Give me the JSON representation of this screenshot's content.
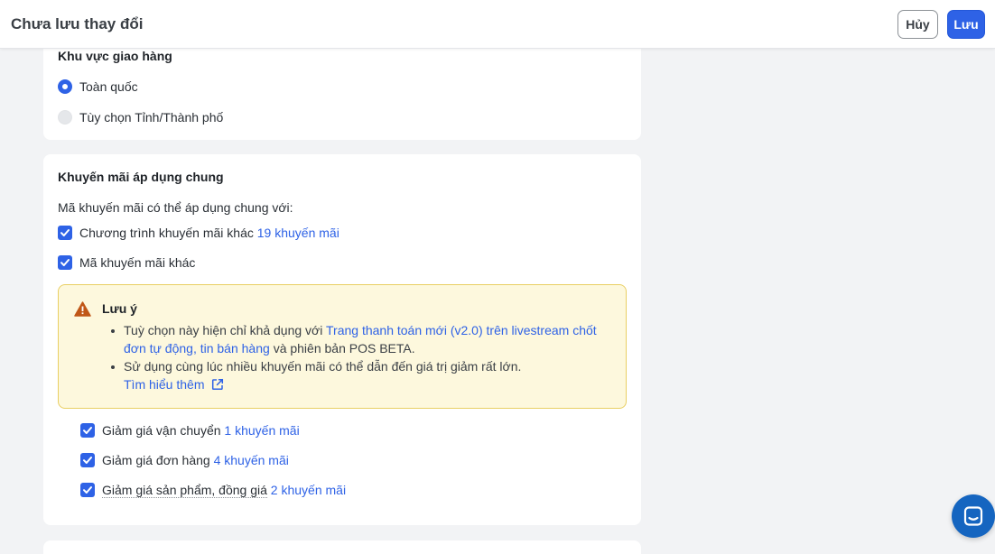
{
  "header": {
    "title": "Chưa lưu thay đổi",
    "cancel_label": "Hủy",
    "save_label": "Lưu"
  },
  "shipping_area": {
    "heading": "Khu vực giao hàng",
    "options": [
      {
        "label": "Toàn quốc",
        "selected": true
      },
      {
        "label": "Tùy chọn Tỉnh/Thành phố",
        "selected": false
      }
    ]
  },
  "combine": {
    "heading": "Khuyến mãi áp dụng chung",
    "description": "Mã khuyến mãi có thể áp dụng chung với:",
    "options": [
      {
        "label": "Chương trình khuyến mãi khác",
        "count_link": "19 khuyến mãi",
        "checked": true
      },
      {
        "label": "Mã khuyến mãi khác",
        "checked": true
      }
    ],
    "note": {
      "title": "Lưu ý",
      "bullet1_prefix": "Tuỳ chọn này hiện chỉ khả dụng với",
      "bullet1_link1": "Trang thanh toán mới (v2.0) trên livestream",
      "bullet1_link2": "chốt đơn tự động, tin bán hàng",
      "bullet1_suffix": "và phiên bản POS BETA.",
      "bullet2_text": "Sử dụng cùng lúc nhiều khuyến mãi có thể dẫn đến giá trị giảm rất lớn.",
      "learn_more": "Tìm hiểu thêm"
    },
    "sub_options": [
      {
        "label": "Giảm giá vận chuyển",
        "count_link": "1 khuyến mãi",
        "checked": true
      },
      {
        "label": "Giảm giá đơn hàng",
        "count_link": "4 khuyến mãi",
        "checked": true
      },
      {
        "label": "Giảm giá sản phẩm, đồng giá",
        "count_link": "2 khuyến mãi",
        "checked": true
      }
    ]
  },
  "colors": {
    "accent": "#2e62e6",
    "note_bg": "#fdf8dd",
    "note_border": "#e9cf63",
    "warning": "#c05717",
    "chat": "#1565c0"
  },
  "icons": [
    "warning-icon",
    "external-link-icon",
    "checkmark-icon",
    "chat-icon"
  ]
}
